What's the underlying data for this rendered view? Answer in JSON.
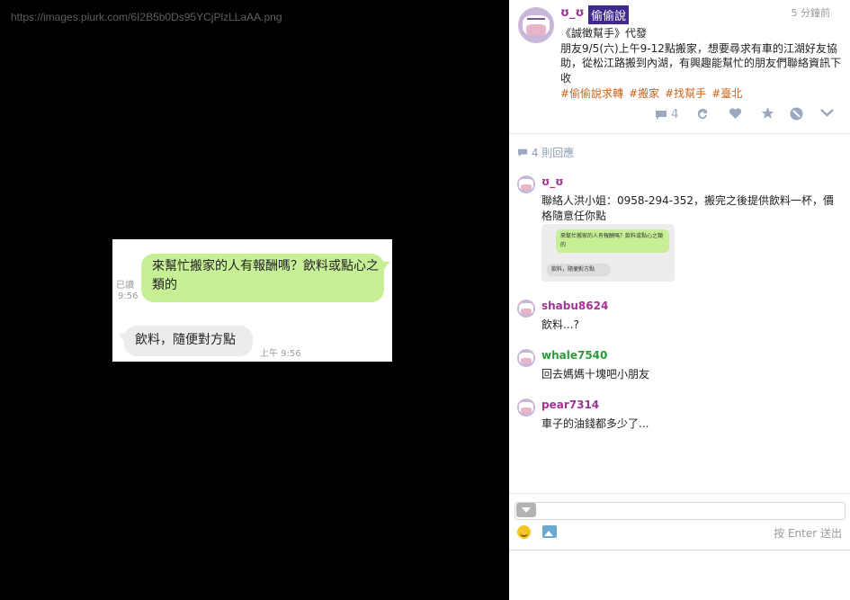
{
  "image_url": "https://images.plurk.com/6I2B5b0Ds95YCjPlzLLaAA.png",
  "chat": {
    "bubble_sent": "來幫忙搬家的人有報酬嗎？飲料或點心之類的",
    "read_label": "已讀",
    "sent_time": "9:56",
    "bubble_reply": "飲料，隨便對方點",
    "reply_time": "上午 9:56"
  },
  "post": {
    "author": "ʊ_ʊ",
    "qualifier": "偷偷說",
    "time": "5 分鐘前",
    "text": "《誠徵幫手》代發\n朋友9/5(六)上午9-12點搬家，想要尋求有車的江湖好友協助，從松江路搬到內湖，有興趣能幫忙的朋友們聯絡資訊下收",
    "tags": [
      "#偷偷說求轉",
      "#搬家",
      "#找幫手",
      "#臺北"
    ],
    "response_count": "4",
    "icons": [
      "comment-icon",
      "replurk-icon",
      "heart-icon",
      "star-icon",
      "mute-icon",
      "chevron-down-icon"
    ]
  },
  "responses_header": "4 則回應",
  "responses": [
    {
      "name": "ʊ_ʊ",
      "color": "#a03496",
      "text": "聯絡人洪小姐：0958-294-352，搬完之後提供飲料一杯，價格隨意任你點",
      "thumb_bubble1": "來幫忙搬家的人有報酬嗎？飲料或點心之類的",
      "thumb_bubble2": "飲料，隨便對方點"
    },
    {
      "name": "shabu8624",
      "color": "#a03496",
      "text": "飲料...?"
    },
    {
      "name": "whale7540",
      "color": "#2d9a3a",
      "text": "回去媽媽十塊吧小朋友"
    },
    {
      "name": "pear7314",
      "color": "#a03496",
      "text": "車子的油錢都多少了..."
    }
  ],
  "input": {
    "hint": "按 Enter 送出"
  }
}
